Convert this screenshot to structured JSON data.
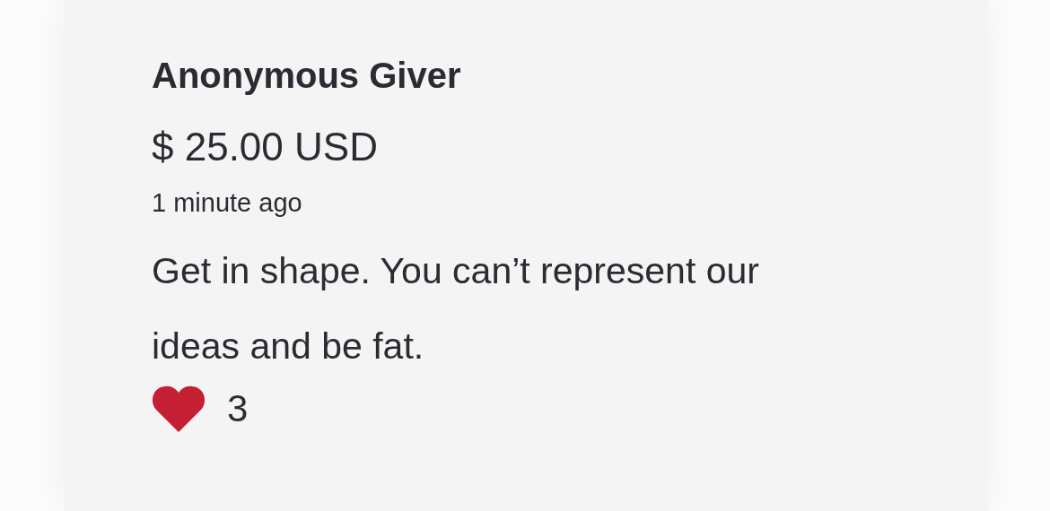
{
  "donation": {
    "donor": "Anonymous Giver",
    "amount": "$ 25.00 USD",
    "time": "1 minute ago",
    "message": "Get in shape. You can’t represent our ideas and be fat.",
    "likes": "3"
  }
}
